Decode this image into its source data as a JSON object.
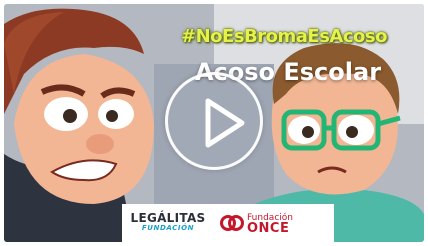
{
  "video": {
    "hashtag": "#NoEsBromaEsAcoso",
    "subtitle": "Acoso Escolar",
    "play_button": "play-icon"
  },
  "logos": {
    "legalitas_main": "LEGÁLITAS",
    "legalitas_sub": "FUNDACIÓN",
    "once_small": "Fundación",
    "once_big": "ONCE"
  },
  "colors": {
    "hashtag": "#e8f04a",
    "once_red": "#c5172b",
    "legalitas_blue": "#1aa0c8",
    "glasses_green": "#22b573"
  }
}
